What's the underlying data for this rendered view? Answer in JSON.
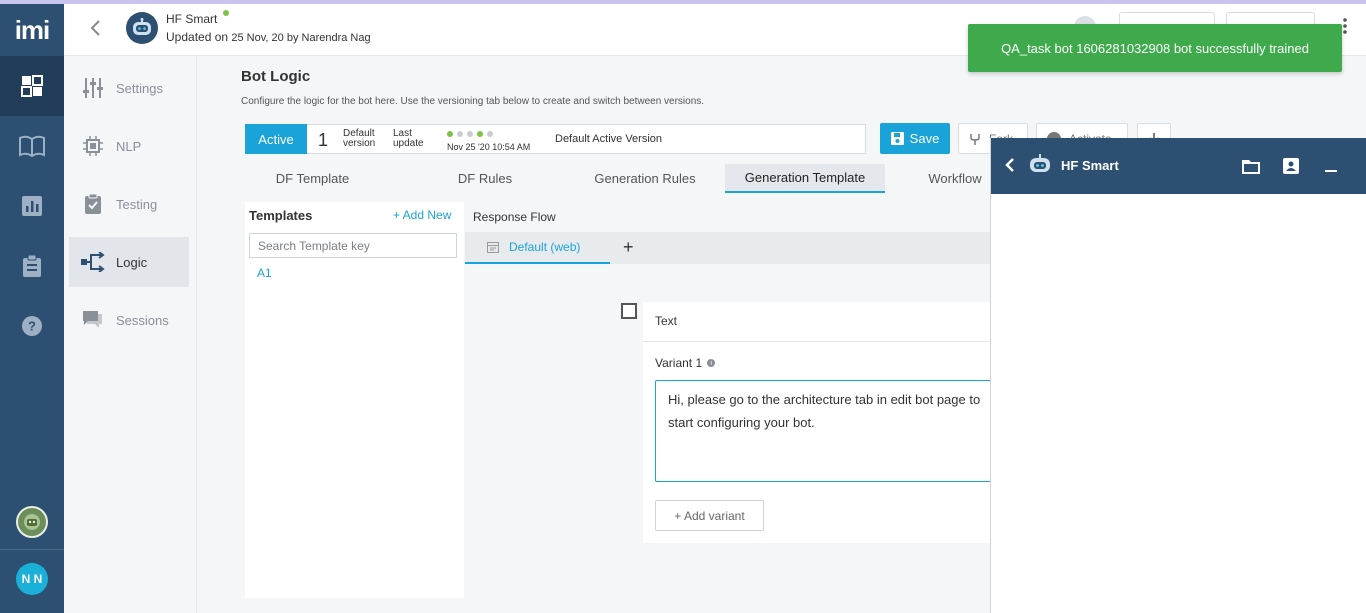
{
  "rail": {
    "logo": "imi",
    "user_initials": "N N"
  },
  "header": {
    "bot_name": "HF Smart",
    "updated_prefix": "Updated on ",
    "updated_date": "25 Nov, 20 by Narendra Nag"
  },
  "subnav": {
    "items": [
      {
        "label": "Settings",
        "icon": "sliders-icon"
      },
      {
        "label": "NLP",
        "icon": "chip-icon"
      },
      {
        "label": "Testing",
        "icon": "clipboard-check-icon"
      },
      {
        "label": "Logic",
        "icon": "flow-icon"
      },
      {
        "label": "Sessions",
        "icon": "chat-icon"
      }
    ]
  },
  "page": {
    "title": "Bot Logic",
    "description": "Configure the logic for the bot here. Use the versioning tab below to create and switch between versions."
  },
  "version_bar": {
    "status": "Active",
    "number": "1",
    "label_default_1": "Default",
    "label_default_2": "version",
    "label_update_1": "Last",
    "label_update_2": "update",
    "date": "Nov 25 '20 10:54 AM",
    "name": "Default Active Version"
  },
  "actions": {
    "save": "Save",
    "fork": "Fork",
    "activate": "Activate"
  },
  "tabs": [
    "DF Template",
    "DF Rules",
    "Generation Rules",
    "Generation Template",
    "Workflow"
  ],
  "active_tab": "Generation Template",
  "templates": {
    "title": "Templates",
    "add_new": "+ Add New",
    "search_placeholder": "Search Template key",
    "items": [
      "A1"
    ]
  },
  "response_flow": {
    "title": "Response Flow",
    "channel_tab": "Default (web)",
    "add": "+"
  },
  "card": {
    "title": "Text",
    "variant_label": "Variant 1",
    "info": "i",
    "variant_text": "Hi, please go to the architecture tab in edit bot page to start configuring your bot.",
    "add_variant": "+ Add variant"
  },
  "toast": {
    "message": "QA_task bot 1606281032908 bot successfully trained",
    "color": "#3eaa4b"
  },
  "chat_window": {
    "bot_name": "HF Smart"
  },
  "colors": {
    "rail": "#2d4f71",
    "accent": "#1aa3d9"
  }
}
